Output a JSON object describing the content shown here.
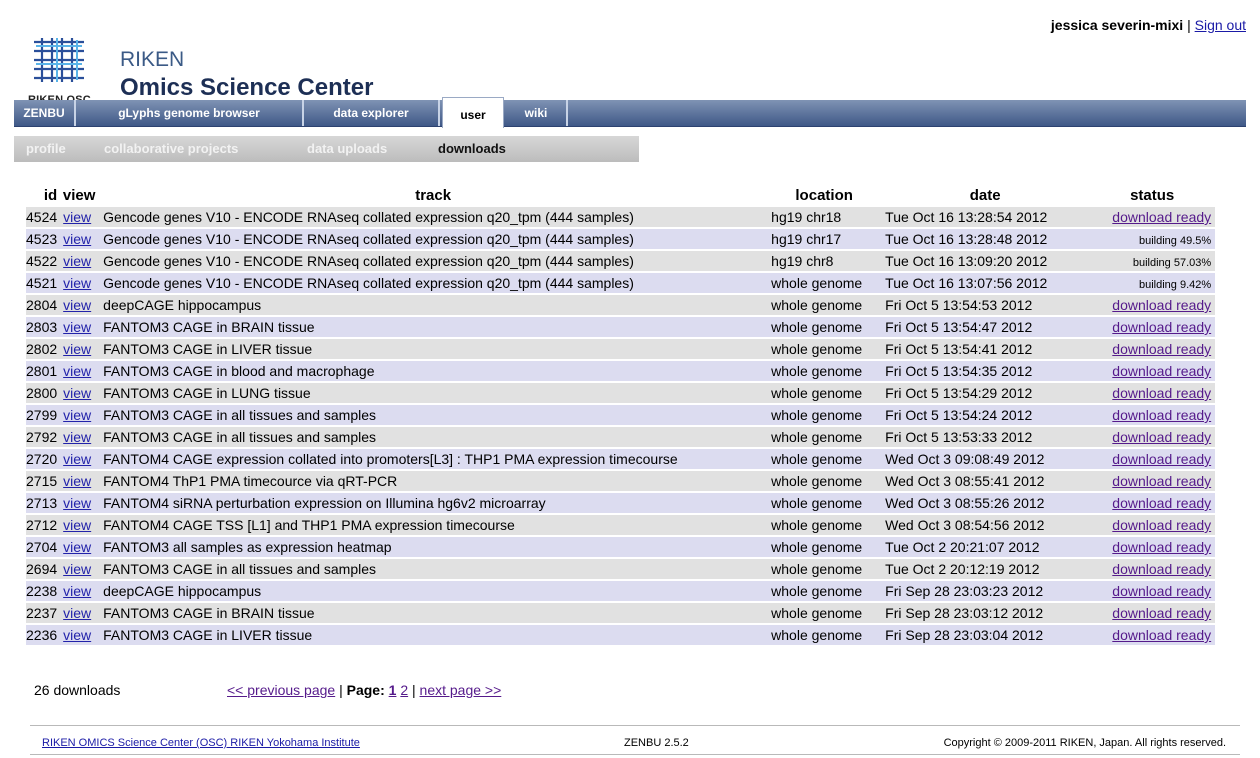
{
  "header": {
    "logo_osc": "RIKEN OSC",
    "logo_riken": "RIKEN",
    "logo_title": "Omics Science Center",
    "user_name": "jessica severin-mixi",
    "separator": "|",
    "sign_out": "Sign out"
  },
  "tabs": [
    {
      "label": "ZENBU"
    },
    {
      "label": "gLyphs genome browser"
    },
    {
      "label": "data explorer"
    },
    {
      "label": "user",
      "active": true
    },
    {
      "label": "wiki"
    }
  ],
  "subnav": [
    {
      "label": "profile"
    },
    {
      "label": "collaborative projects"
    },
    {
      "label": "data uploads"
    },
    {
      "label": "downloads",
      "active": true
    }
  ],
  "table": {
    "headers": {
      "id": "id",
      "view": "view",
      "track": "track",
      "location": "location",
      "date": "date",
      "status": "status"
    },
    "rows": [
      {
        "id": "4524",
        "view": "view",
        "track": "Gencode genes V10 - ENCODE RNAseq collated expression q20_tpm (444 samples)",
        "location": "hg19 chr18",
        "date": "Tue Oct 16 13:28:54 2012",
        "status": "download ready"
      },
      {
        "id": "4523",
        "view": "view",
        "track": "Gencode genes V10 - ENCODE RNAseq collated expression q20_tpm (444 samples)",
        "location": "hg19 chr17",
        "date": "Tue Oct 16 13:28:48 2012",
        "status": "building 49.5%"
      },
      {
        "id": "4522",
        "view": "view",
        "track": "Gencode genes V10 - ENCODE RNAseq collated expression q20_tpm (444 samples)",
        "location": "hg19 chr8",
        "date": "Tue Oct 16 13:09:20 2012",
        "status": "building 57.03%"
      },
      {
        "id": "4521",
        "view": "view",
        "track": "Gencode genes V10 - ENCODE RNAseq collated expression q20_tpm (444 samples)",
        "location": "whole genome",
        "date": "Tue Oct 16 13:07:56 2012",
        "status": "building 9.42%"
      },
      {
        "id": "2804",
        "view": "view",
        "track": "deepCAGE hippocampus",
        "location": "whole genome",
        "date": "Fri Oct 5 13:54:53 2012",
        "status": "download ready"
      },
      {
        "id": "2803",
        "view": "view",
        "track": "FANTOM3 CAGE in BRAIN tissue",
        "location": "whole genome",
        "date": "Fri Oct 5 13:54:47 2012",
        "status": "download ready"
      },
      {
        "id": "2802",
        "view": "view",
        "track": "FANTOM3 CAGE in LIVER tissue",
        "location": "whole genome",
        "date": "Fri Oct 5 13:54:41 2012",
        "status": "download ready"
      },
      {
        "id": "2801",
        "view": "view",
        "track": "FANTOM3 CAGE in blood and macrophage",
        "location": "whole genome",
        "date": "Fri Oct 5 13:54:35 2012",
        "status": "download ready"
      },
      {
        "id": "2800",
        "view": "view",
        "track": "FANTOM3 CAGE in LUNG tissue",
        "location": "whole genome",
        "date": "Fri Oct 5 13:54:29 2012",
        "status": "download ready"
      },
      {
        "id": "2799",
        "view": "view",
        "track": "FANTOM3 CAGE in all tissues and samples",
        "location": "whole genome",
        "date": "Fri Oct 5 13:54:24 2012",
        "status": "download ready"
      },
      {
        "id": "2792",
        "view": "view",
        "track": "FANTOM3 CAGE in all tissues and samples",
        "location": "whole genome",
        "date": "Fri Oct 5 13:53:33 2012",
        "status": "download ready"
      },
      {
        "id": "2720",
        "view": "view",
        "track": "FANTOM4 CAGE expression collated into promoters[L3] : THP1 PMA expression timecourse",
        "location": "whole genome",
        "date": "Wed Oct 3 09:08:49 2012",
        "status": "download ready"
      },
      {
        "id": "2715",
        "view": "view",
        "track": "FANTOM4 ThP1 PMA timecource via qRT-PCR",
        "location": "whole genome",
        "date": "Wed Oct 3 08:55:41 2012",
        "status": "download ready"
      },
      {
        "id": "2713",
        "view": "view",
        "track": "FANTOM4 siRNA perturbation expression on Illumina hg6v2 microarray",
        "location": "whole genome",
        "date": "Wed Oct 3 08:55:26 2012",
        "status": "download ready"
      },
      {
        "id": "2712",
        "view": "view",
        "track": "FANTOM4 CAGE TSS [L1] and THP1 PMA expression timecourse",
        "location": "whole genome",
        "date": "Wed Oct 3 08:54:56 2012",
        "status": "download ready"
      },
      {
        "id": "2704",
        "view": "view",
        "track": "FANTOM3 all samples as expression heatmap",
        "location": "whole genome",
        "date": "Tue Oct 2 20:21:07 2012",
        "status": "download ready"
      },
      {
        "id": "2694",
        "view": "view",
        "track": "FANTOM3 CAGE in all tissues and samples",
        "location": "whole genome",
        "date": "Tue Oct 2 20:12:19 2012",
        "status": "download ready"
      },
      {
        "id": "2238",
        "view": "view",
        "track": "deepCAGE hippocampus",
        "location": "whole genome",
        "date": "Fri Sep 28 23:03:23 2012",
        "status": "download ready"
      },
      {
        "id": "2237",
        "view": "view",
        "track": "FANTOM3 CAGE in BRAIN tissue",
        "location": "whole genome",
        "date": "Fri Sep 28 23:03:12 2012",
        "status": "download ready"
      },
      {
        "id": "2236",
        "view": "view",
        "track": "FANTOM3 CAGE in LIVER tissue",
        "location": "whole genome",
        "date": "Fri Sep 28 23:03:04 2012",
        "status": "download ready"
      }
    ]
  },
  "pager": {
    "count": "26 downloads",
    "previous": "<< previous page",
    "sep1": "|",
    "page_label": "Page:",
    "page1": "1",
    "page2": "2",
    "sep2": "|",
    "next": "next page >>"
  },
  "footer": {
    "left_link": "RIKEN OMICS Science Center (OSC) RIKEN Yokohama Institute",
    "center": "ZENBU 2.5.2",
    "right": "Copyright © 2009-2011 RIKEN, Japan. All rights reserved."
  }
}
